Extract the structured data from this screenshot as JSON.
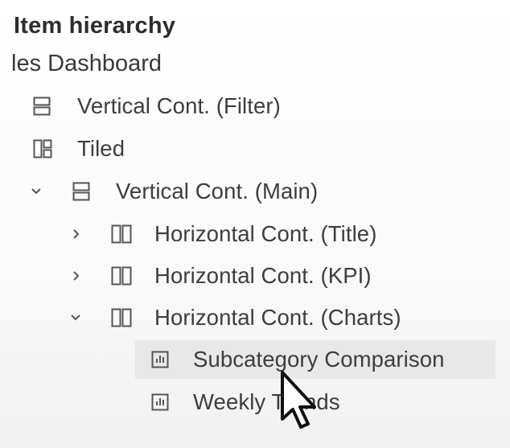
{
  "panel": {
    "title": "Item hierarchy",
    "dashboard_name": "les Dashboard"
  },
  "tree": {
    "items": [
      {
        "label": "Vertical Cont. (Filter)",
        "icon": "vertical-container-icon",
        "chevron": "none"
      },
      {
        "label": "Tiled",
        "icon": "tiled-layout-icon",
        "chevron": "none"
      },
      {
        "label": "Vertical Cont. (Main)",
        "icon": "vertical-container-icon",
        "chevron": "expanded"
      },
      {
        "label": "Horizontal Cont. (Title)",
        "icon": "horizontal-container-icon",
        "chevron": "collapsed"
      },
      {
        "label": "Horizontal Cont. (KPI)",
        "icon": "horizontal-container-icon",
        "chevron": "collapsed"
      },
      {
        "label": "Horizontal Cont. (Charts)",
        "icon": "horizontal-container-icon",
        "chevron": "expanded"
      },
      {
        "label": "Subcategory Comparison",
        "icon": "sheet-icon",
        "chevron": "none",
        "selected": true
      },
      {
        "label": "Weekly Trends",
        "icon": "sheet-icon",
        "chevron": "none"
      }
    ]
  },
  "colors": {
    "selected_row": "#e8e8e8",
    "text": "#3d3d3d",
    "icon_stroke": "#555555"
  },
  "cursor": {
    "icon": "mouse-pointer-icon"
  }
}
